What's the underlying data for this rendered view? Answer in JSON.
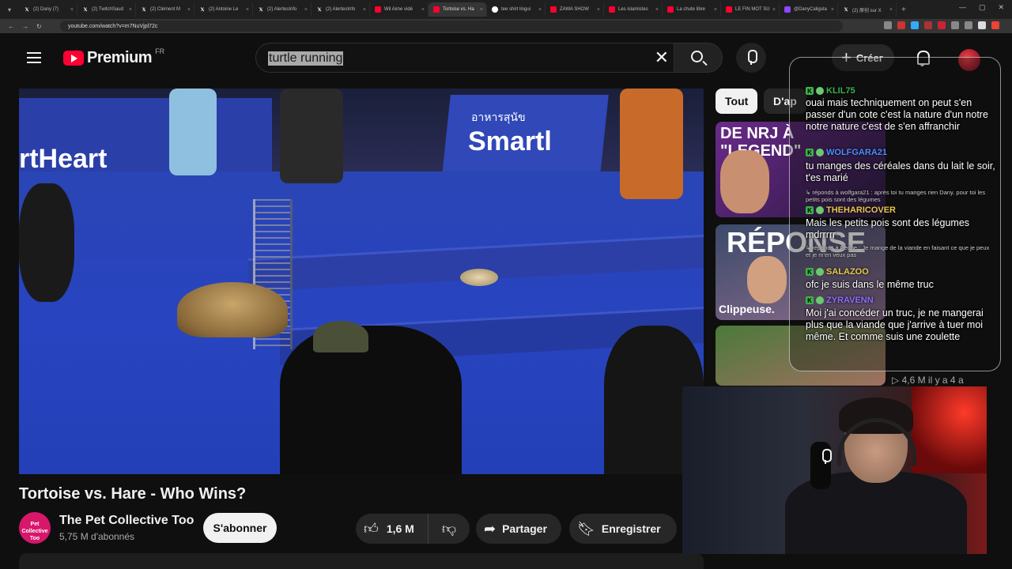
{
  "browser": {
    "tabs": [
      {
        "label": "(2) Dany (7)",
        "icon": "x"
      },
      {
        "label": "(2) TwitchSaud",
        "icon": "x"
      },
      {
        "label": "(2) Clément M",
        "icon": "x"
      },
      {
        "label": "(2) Antoine Le",
        "icon": "x"
      },
      {
        "label": "(2) AlertesInfo",
        "icon": "x"
      },
      {
        "label": "(2) AlertesInfo",
        "icon": "x"
      },
      {
        "label": "Wil Aime vidé",
        "icon": "yt"
      },
      {
        "label": "Tortoise vs. Ha",
        "icon": "yt",
        "active": true
      },
      {
        "label": "tee shirt lingui",
        "icon": "g"
      },
      {
        "label": "ZAWA SHOW",
        "icon": "yt"
      },
      {
        "label": "Les islamistes",
        "icon": "yt"
      },
      {
        "label": "La chute libre",
        "icon": "yt"
      },
      {
        "label": "LE FIN MOT SU",
        "icon": "yt"
      },
      {
        "label": "@DanyCaligula",
        "icon": "tw"
      },
      {
        "label": "(2) 原创 sur X",
        "icon": "x"
      }
    ],
    "url": "youtube.com/watch?v=m7NuVjpl72c",
    "ext_colors": [
      "#888",
      "#c33",
      "#3af",
      "#a33",
      "#c23",
      "#888",
      "#888",
      "#ddd",
      "#e43"
    ]
  },
  "header": {
    "logo_text": "Premium",
    "country": "FR",
    "search_query": "turtle running",
    "create_label": "Créer"
  },
  "video": {
    "title": "Tortoise vs. Hare - Who Wins?",
    "overlay_texts": {
      "left": "rtHeart",
      "right": "Smartl",
      "thai": "อาหารสุนัข"
    },
    "channel_name": "The Pet Collective Too",
    "channel_avatar_text": "Pet Collective Too",
    "subscribers": "5,75 M d'abonnés",
    "subscribe_label": "S'abonner",
    "likes": "1,6 M",
    "share_label": "Partager",
    "save_label": "Enregistrer"
  },
  "sidebar": {
    "chips": [
      "Tout",
      "D'ap"
    ],
    "thumbs": [
      {
        "text": "DE NRJ À\n\"LEGEND\""
      },
      {
        "text": "RÉPONSE",
        "sub": "Clippeuse."
      },
      {
        "text": ""
      }
    ],
    "views": "4,6 M",
    "age": "il y a 4 a"
  },
  "chat": {
    "messages": [
      {
        "user": "KLIL75",
        "color": "#3bb24a",
        "text": "ouai mais techniquement on peut s'en passer d'un cote c'est la nature d'un notre notre nature c'est de s'en affranchir"
      },
      {
        "user": "WOLFGARA21",
        "color": "#4a8cff",
        "text": "tu manges des céréales dans du lait le soir, t'es marié"
      },
      {
        "reply": "↳ réponds à wolfgara21 : après toi tu manges rien Dany. pour toi les petits pois sont des légumes",
        "user": "THEHARICOVER",
        "color": "#e6c84a",
        "text": "Mais les petits pois sont des légumes mdrrrrr"
      },
      {
        "reply": "↳ réponds à Peche : Je mange de la viande en faisant ce que je peux et je m'en veux pas",
        "user": "SALAZOO",
        "color": "#e6c84a",
        "text": "ofc je suis dans le même truc"
      },
      {
        "user": "ZYRAVENN",
        "color": "#8c6cff",
        "text": "Moi j'ai concéder un truc, je ne mangerai plus que la viande que j'arrive à tuer moi même. Et comme suis une zoulette"
      }
    ]
  }
}
